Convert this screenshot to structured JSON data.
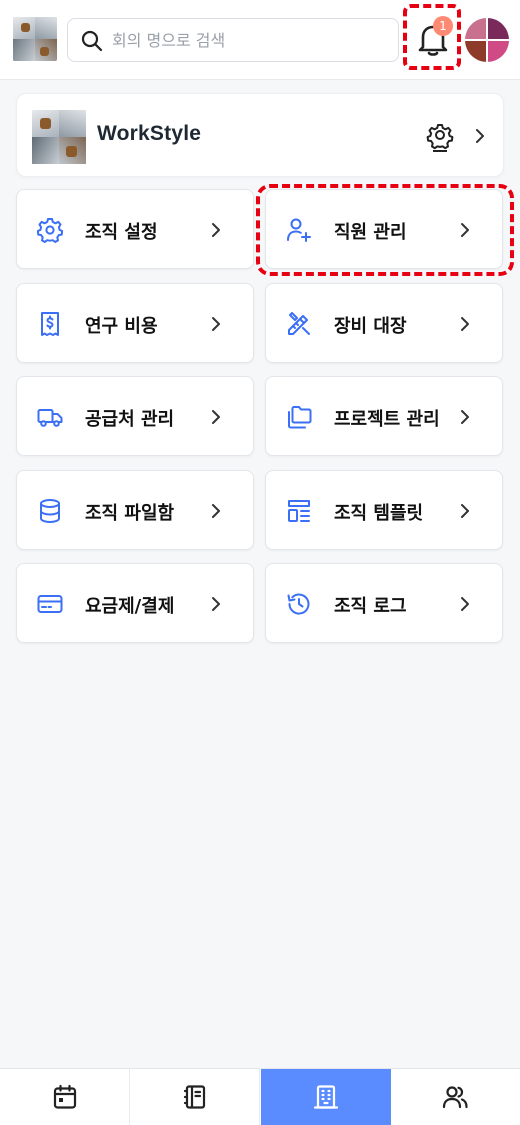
{
  "header": {
    "search": {
      "placeholder": "회의 명으로 검색",
      "value": ""
    },
    "notifications": {
      "count": "1"
    }
  },
  "org": {
    "name": "WorkStyle"
  },
  "menu": [
    {
      "label": "조직 설정",
      "icon": "gear-icon"
    },
    {
      "label": "직원 관리",
      "icon": "user-plus-icon"
    },
    {
      "label": "연구 비용",
      "icon": "receipt-dollar-icon"
    },
    {
      "label": "장비 대장",
      "icon": "tools-icon"
    },
    {
      "label": "공급처 관리",
      "icon": "truck-icon"
    },
    {
      "label": "프로젝트 관리",
      "icon": "folders-icon"
    },
    {
      "label": "조직 파일함",
      "icon": "database-icon"
    },
    {
      "label": "조직 템플릿",
      "icon": "template-icon"
    },
    {
      "label": "요금제/결제",
      "icon": "credit-card-icon"
    },
    {
      "label": "조직 로그",
      "icon": "history-icon"
    }
  ],
  "bottom_nav": [
    {
      "icon": "calendar-icon",
      "active": false
    },
    {
      "icon": "notebook-icon",
      "active": false
    },
    {
      "icon": "building-icon",
      "active": true
    },
    {
      "icon": "users-icon",
      "active": false
    }
  ],
  "colors": {
    "accent": "#5b8cff",
    "icon_blue": "#3b6ff5",
    "highlight_red": "#e60012",
    "badge": "#ff8a73"
  }
}
